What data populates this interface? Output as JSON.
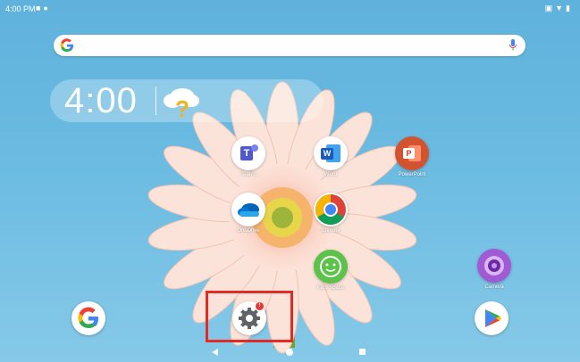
{
  "status_bar": {
    "time": "4:00 PM"
  },
  "clock_widget": {
    "time": "4:00",
    "weather_line1": "- -",
    "weather_line2": "-"
  },
  "apps": {
    "teams": {
      "label": "Teams"
    },
    "word": {
      "label": "Word"
    },
    "powerpoint": {
      "label": "PowerPoint"
    },
    "onedrive": {
      "label": "OneDrive"
    },
    "chrome": {
      "label": "Chrome"
    },
    "kids_space": {
      "label": "Kids Space"
    },
    "camera": {
      "label": "Camera"
    }
  },
  "dock": {
    "settings_badge": "!"
  },
  "colors": {
    "highlight": "#e12b24",
    "wallpaper": "#6bbbe2"
  }
}
